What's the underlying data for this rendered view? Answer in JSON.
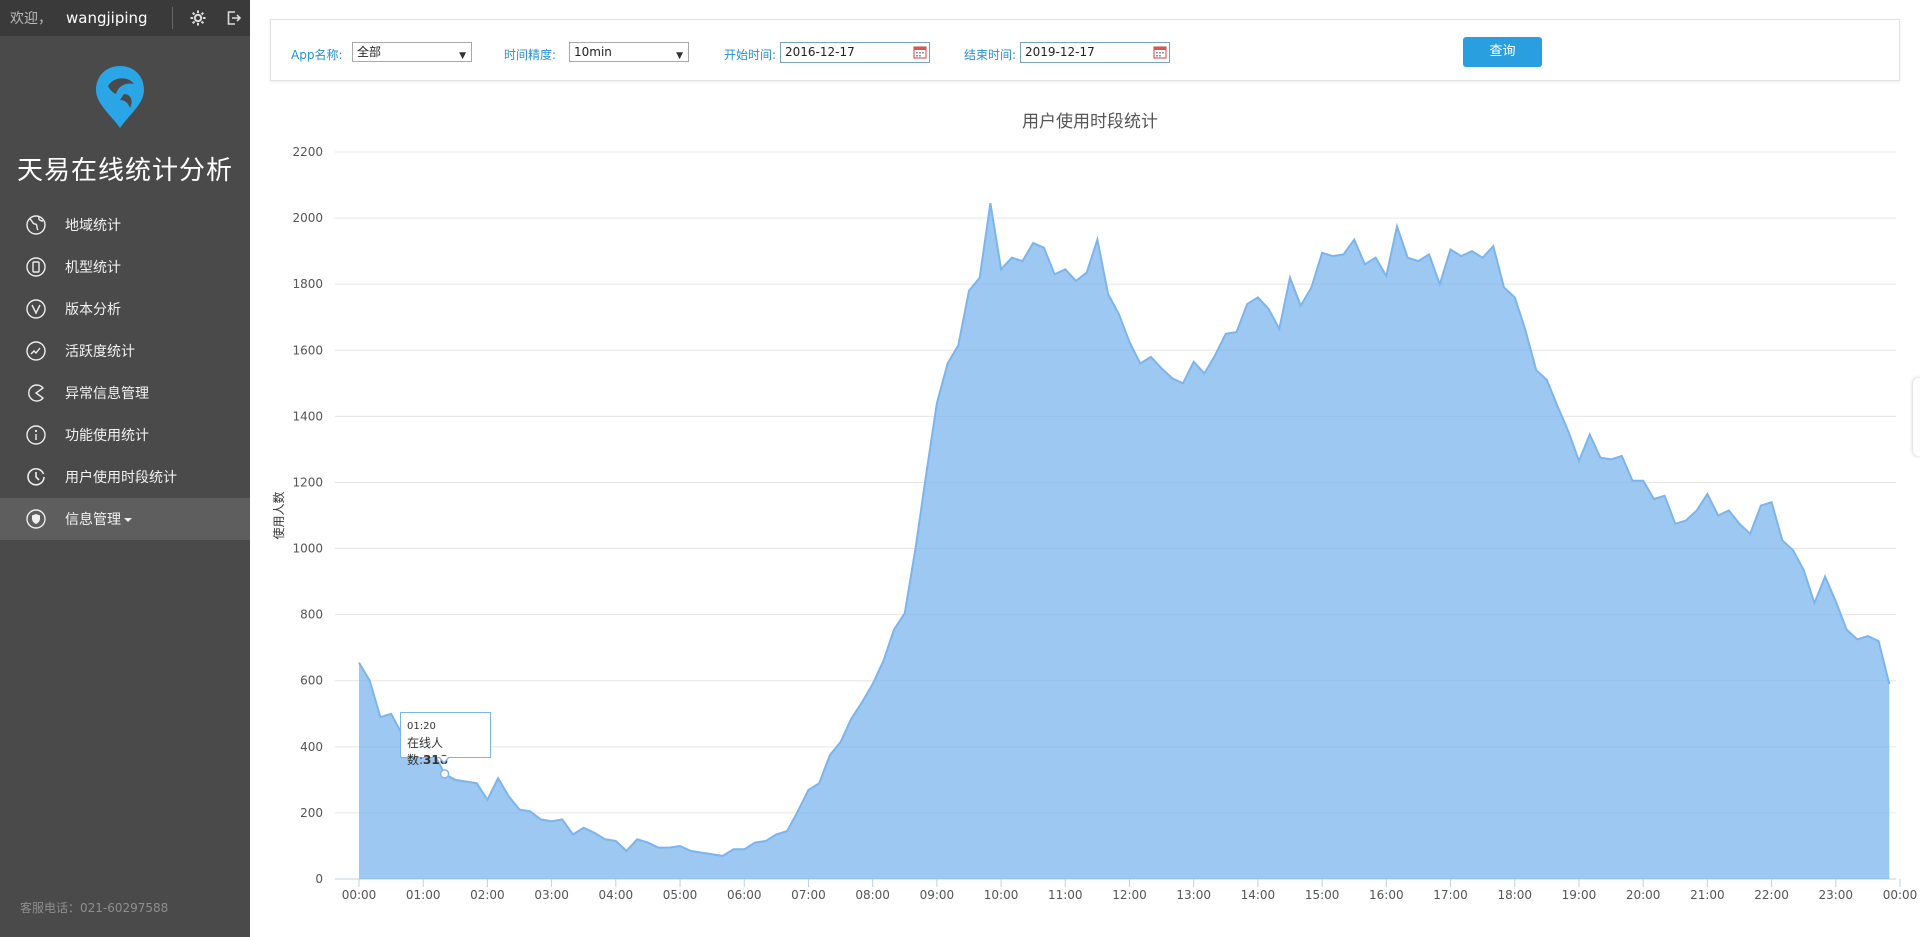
{
  "header": {
    "welcome": "欢迎，",
    "username": "wangjiping"
  },
  "brand": {
    "title": "天易在线统计分析"
  },
  "sidebar": {
    "items": [
      {
        "label": "地域统计",
        "icon": "globe-icon"
      },
      {
        "label": "机型统计",
        "icon": "phone-icon"
      },
      {
        "label": "版本分析",
        "icon": "version-icon"
      },
      {
        "label": "活跃度统计",
        "icon": "activity-chart-icon"
      },
      {
        "label": "异常信息管理",
        "icon": "pacman-icon"
      },
      {
        "label": "功能使用统计",
        "icon": "info-icon"
      },
      {
        "label": "用户使用时段统计",
        "icon": "clock-icon"
      },
      {
        "label": "信息管理",
        "icon": "shield-icon",
        "active": true
      }
    ],
    "hotline": "客服电话：021-60297588"
  },
  "filters": {
    "app_label": "App名称:",
    "app_value": "全部",
    "granularity_label": "时间精度:",
    "granularity_value": "10min",
    "start_label": "开始时间:",
    "start_value": "2016-12-17",
    "end_label": "结束时间:",
    "end_value": "2019-12-17",
    "query_label": "查询"
  },
  "tooltip": {
    "time": "01:20",
    "label": "在线人数:",
    "value": "318"
  },
  "colors": {
    "area": "#7cb5ec",
    "sidebar": "#4a4a4a",
    "button": "#2a9fe0",
    "label": "#2a8fd1"
  },
  "chart_data": {
    "type": "area",
    "title": "用户使用时段统计",
    "ylabel": "使用人数",
    "xlabel": "",
    "ylim": [
      0,
      2200
    ],
    "yticks": [
      0,
      200,
      400,
      600,
      800,
      1000,
      1200,
      1400,
      1600,
      1800,
      2000,
      2200
    ],
    "xtick_labels": [
      "00:00",
      "01:00",
      "02:00",
      "03:00",
      "04:00",
      "05:00",
      "06:00",
      "07:00",
      "08:00",
      "09:00",
      "10:00",
      "11:00",
      "12:00",
      "13:00",
      "14:00",
      "15:00",
      "16:00",
      "17:00",
      "18:00",
      "19:00",
      "20:00",
      "21:00",
      "22:00",
      "23:00",
      "00:00"
    ],
    "interval_minutes": 10,
    "grid": true,
    "legend": "none",
    "series": [
      {
        "values": [
          655,
          600,
          490,
          500,
          440,
          390,
          405,
          380,
          318,
          300,
          295,
          290,
          240,
          305,
          250,
          210,
          205,
          180,
          175,
          180,
          135,
          155,
          140,
          120,
          115,
          85,
          120,
          110,
          95,
          95,
          100,
          85,
          80,
          75,
          70,
          90,
          90,
          110,
          115,
          135,
          145,
          205,
          270,
          290,
          375,
          415,
          485,
          535,
          590,
          660,
          755,
          805,
          1000,
          1225,
          1440,
          1560,
          1615,
          1780,
          1820,
          2045,
          1845,
          1880,
          1870,
          1925,
          1910,
          1830,
          1845,
          1810,
          1835,
          1935,
          1770,
          1710,
          1625,
          1560,
          1580,
          1545,
          1515,
          1500,
          1565,
          1530,
          1585,
          1650,
          1655,
          1740,
          1760,
          1725,
          1665,
          1820,
          1735,
          1790,
          1895,
          1885,
          1890,
          1935,
          1860,
          1880,
          1825,
          1975,
          1880,
          1870,
          1890,
          1800,
          1905,
          1885,
          1900,
          1880,
          1915,
          1790,
          1760,
          1660,
          1540,
          1510,
          1430,
          1355,
          1265,
          1345,
          1275,
          1270,
          1280,
          1205,
          1205,
          1150,
          1160,
          1075,
          1085,
          1115,
          1165,
          1100,
          1115,
          1075,
          1045,
          1130,
          1140,
          1025,
          995,
          935,
          835,
          915,
          840,
          755,
          725,
          735,
          720,
          590
        ]
      }
    ]
  }
}
